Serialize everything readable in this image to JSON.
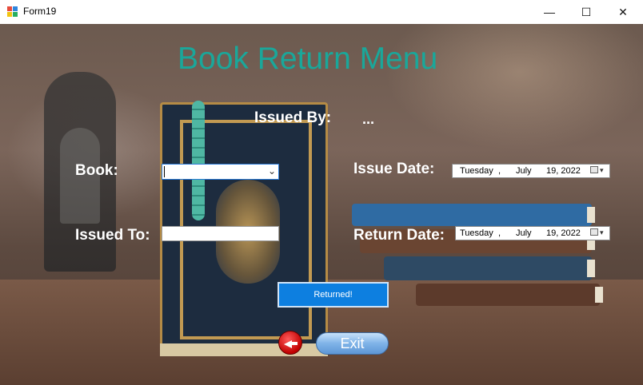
{
  "window": {
    "title": "Form19",
    "minimize_label": "—",
    "maximize_label": "☐",
    "close_label": "✕"
  },
  "form": {
    "heading": "Book Return Menu",
    "issued_by_label": "Issued By:",
    "issued_by_value": "...",
    "book_label": "Book:",
    "book_value": "",
    "issued_to_label": "Issued To:",
    "issued_to_value": "",
    "issue_date_label": "Issue Date:",
    "issue_date": {
      "weekday": "Tuesday",
      "sep": ",",
      "month": "July",
      "day_year": "19, 2022"
    },
    "return_date_label": "Return Date:",
    "return_date": {
      "weekday": "Tuesday",
      "sep": ",",
      "month": "July",
      "day_year": "19, 2022"
    },
    "returned_button": "Returned!",
    "exit_button": "Exit"
  },
  "colors": {
    "heading": "#1aa79a",
    "returned_button_bg": "#0d7fe0",
    "label_text": "#ffffff"
  },
  "icons": [
    "app-form-icon",
    "back-arrow-icon",
    "calendar-icon",
    "chevron-down-icon"
  ]
}
